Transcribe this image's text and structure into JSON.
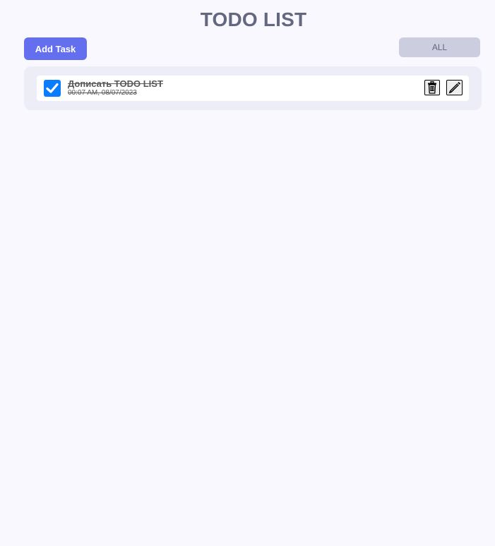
{
  "header": {
    "title": "TODO LIST"
  },
  "toolbar": {
    "add_label": "Add Task",
    "filter_value": "ALL"
  },
  "todos": [
    {
      "title": "Дописать TODO LIST",
      "time": "00:07 AM, 08/07/2023",
      "completed": true
    }
  ],
  "colors": {
    "background": "#f8f8fe",
    "accent": "#646ff0",
    "checkbox": "#0a7cff",
    "filter_bg": "#cccdde",
    "list_bg": "#ecedf6",
    "title": "#636780"
  },
  "icons": {
    "delete": "trash-icon",
    "edit": "pencil-icon",
    "check": "checkmark-icon"
  }
}
